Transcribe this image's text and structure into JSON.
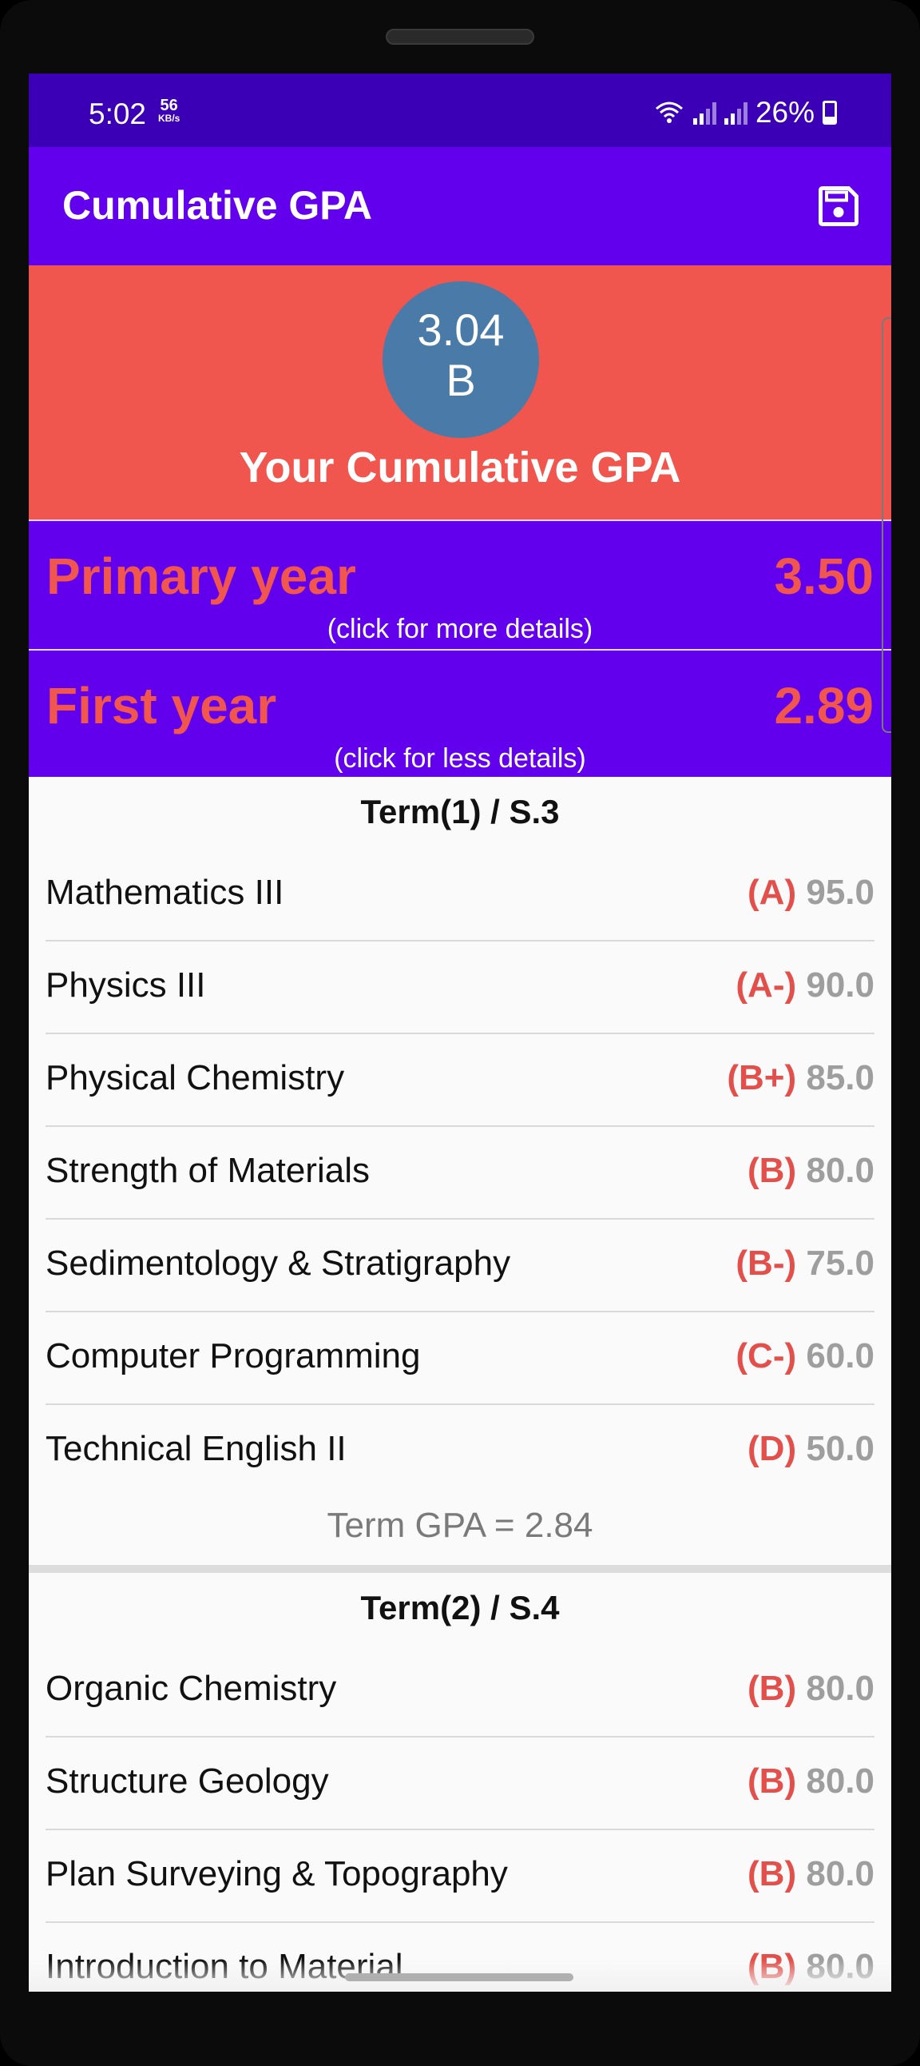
{
  "status_bar": {
    "time": "5:02",
    "speed_value": "56",
    "speed_unit": "KB/s",
    "battery": "26%"
  },
  "app_bar": {
    "title": "Cumulative GPA",
    "save_icon": "save-icon"
  },
  "summary": {
    "gpa": "3.04",
    "grade": "B",
    "caption": "Your Cumulative GPA"
  },
  "years": [
    {
      "name": "Primary year",
      "gpa": "3.50",
      "hint": "(click for more details)"
    },
    {
      "name": "First year",
      "gpa": "2.89",
      "hint": "(click for less details)"
    }
  ],
  "terms": [
    {
      "title": "Term(1) / S.3",
      "courses": [
        {
          "name": "Mathematics III",
          "grade": "(A)",
          "score": "95.0"
        },
        {
          "name": "Physics III",
          "grade": "(A-)",
          "score": "90.0"
        },
        {
          "name": "Physical Chemistry",
          "grade": "(B+)",
          "score": "85.0"
        },
        {
          "name": "Strength of Materials",
          "grade": "(B)",
          "score": "80.0"
        },
        {
          "name": "Sedimentology & Stratigraphy",
          "grade": "(B-)",
          "score": "75.0"
        },
        {
          "name": "Computer Programming",
          "grade": "(C-)",
          "score": "60.0"
        },
        {
          "name": "Technical English II",
          "grade": "(D)",
          "score": "50.0"
        }
      ],
      "term_gpa": "Term GPA = 2.84"
    },
    {
      "title": "Term(2) / S.4",
      "courses": [
        {
          "name": "Organic Chemistry",
          "grade": "(B)",
          "score": "80.0"
        },
        {
          "name": "Structure Geology",
          "grade": "(B)",
          "score": "80.0"
        },
        {
          "name": "Plan Surveying & Topography",
          "grade": "(B)",
          "score": "80.0"
        },
        {
          "name": "Introduction to Material",
          "grade": "(B)",
          "score": "80.0"
        }
      ]
    }
  ],
  "colors": {
    "primary": "#6200ee",
    "status_bar": "#3b00b6",
    "accent": "#f0554e",
    "circle": "#4a7ba8"
  }
}
